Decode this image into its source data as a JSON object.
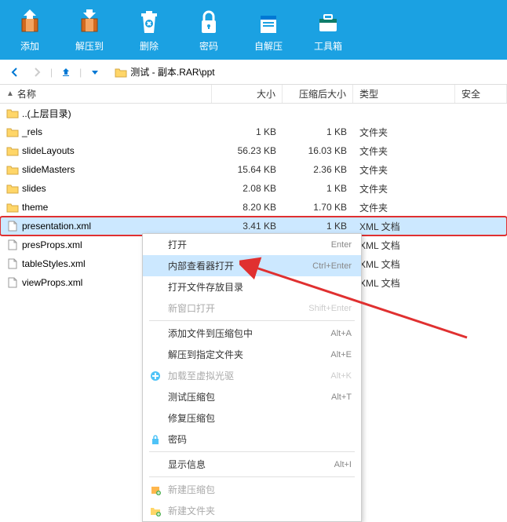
{
  "toolbar": [
    {
      "icon": "add",
      "label": "添加"
    },
    {
      "icon": "extract",
      "label": "解压到"
    },
    {
      "icon": "delete",
      "label": "删除"
    },
    {
      "icon": "password",
      "label": "密码"
    },
    {
      "icon": "sfx",
      "label": "自解压"
    },
    {
      "icon": "toolbox",
      "label": "工具箱"
    }
  ],
  "breadcrumb": "测试 - 副本.RAR\\ppt",
  "columns": {
    "name": "名称",
    "size": "大小",
    "packed": "压缩后大小",
    "type": "类型",
    "secure": "安全"
  },
  "files": [
    {
      "icon": "folder",
      "name": "..(上层目录)",
      "size": "",
      "packed": "",
      "type": ""
    },
    {
      "icon": "folder",
      "name": "_rels",
      "size": "1 KB",
      "packed": "1 KB",
      "type": "文件夹"
    },
    {
      "icon": "folder",
      "name": "slideLayouts",
      "size": "56.23 KB",
      "packed": "16.03 KB",
      "type": "文件夹"
    },
    {
      "icon": "folder",
      "name": "slideMasters",
      "size": "15.64 KB",
      "packed": "2.36 KB",
      "type": "文件夹"
    },
    {
      "icon": "folder",
      "name": "slides",
      "size": "2.08 KB",
      "packed": "1 KB",
      "type": "文件夹"
    },
    {
      "icon": "folder",
      "name": "theme",
      "size": "8.20 KB",
      "packed": "1.70 KB",
      "type": "文件夹"
    },
    {
      "icon": "file",
      "name": "presentation.xml",
      "size": "3.41 KB",
      "packed": "1 KB",
      "type": "XML 文档",
      "selected": true,
      "highlighted": true
    },
    {
      "icon": "file",
      "name": "presProps.xml",
      "size": "",
      "packed": "",
      "type": "XML 文档"
    },
    {
      "icon": "file",
      "name": "tableStyles.xml",
      "size": "",
      "packed": "",
      "type": "XML 文档"
    },
    {
      "icon": "file",
      "name": "viewProps.xml",
      "size": "",
      "packed": "",
      "type": "XML 文档"
    }
  ],
  "contextMenu": [
    {
      "type": "item",
      "label": "打开",
      "shortcut": "Enter"
    },
    {
      "type": "item",
      "label": "内部查看器打开",
      "shortcut": "Ctrl+Enter",
      "hover": true
    },
    {
      "type": "item",
      "label": "打开文件存放目录",
      "shortcut": ""
    },
    {
      "type": "item",
      "label": "新窗口打开",
      "shortcut": "Shift+Enter",
      "disabled": true
    },
    {
      "type": "sep"
    },
    {
      "type": "item",
      "label": "添加文件到压缩包中",
      "shortcut": "Alt+A"
    },
    {
      "type": "item",
      "label": "解压到指定文件夹",
      "shortcut": "Alt+E"
    },
    {
      "type": "item",
      "label": "加载至虚拟光驱",
      "shortcut": "Alt+K",
      "disabled": true,
      "icon": "plus"
    },
    {
      "type": "item",
      "label": "测试压缩包",
      "shortcut": "Alt+T"
    },
    {
      "type": "item",
      "label": "修复压缩包",
      "shortcut": ""
    },
    {
      "type": "item",
      "label": "密码",
      "shortcut": "",
      "icon": "lock"
    },
    {
      "type": "sep"
    },
    {
      "type": "item",
      "label": "显示信息",
      "shortcut": "Alt+I"
    },
    {
      "type": "sep"
    },
    {
      "type": "item",
      "label": "新建压缩包",
      "shortcut": "",
      "icon": "archive-new",
      "disabled": true
    },
    {
      "type": "item",
      "label": "新建文件夹",
      "shortcut": "",
      "icon": "folder-new",
      "disabled": true
    }
  ]
}
